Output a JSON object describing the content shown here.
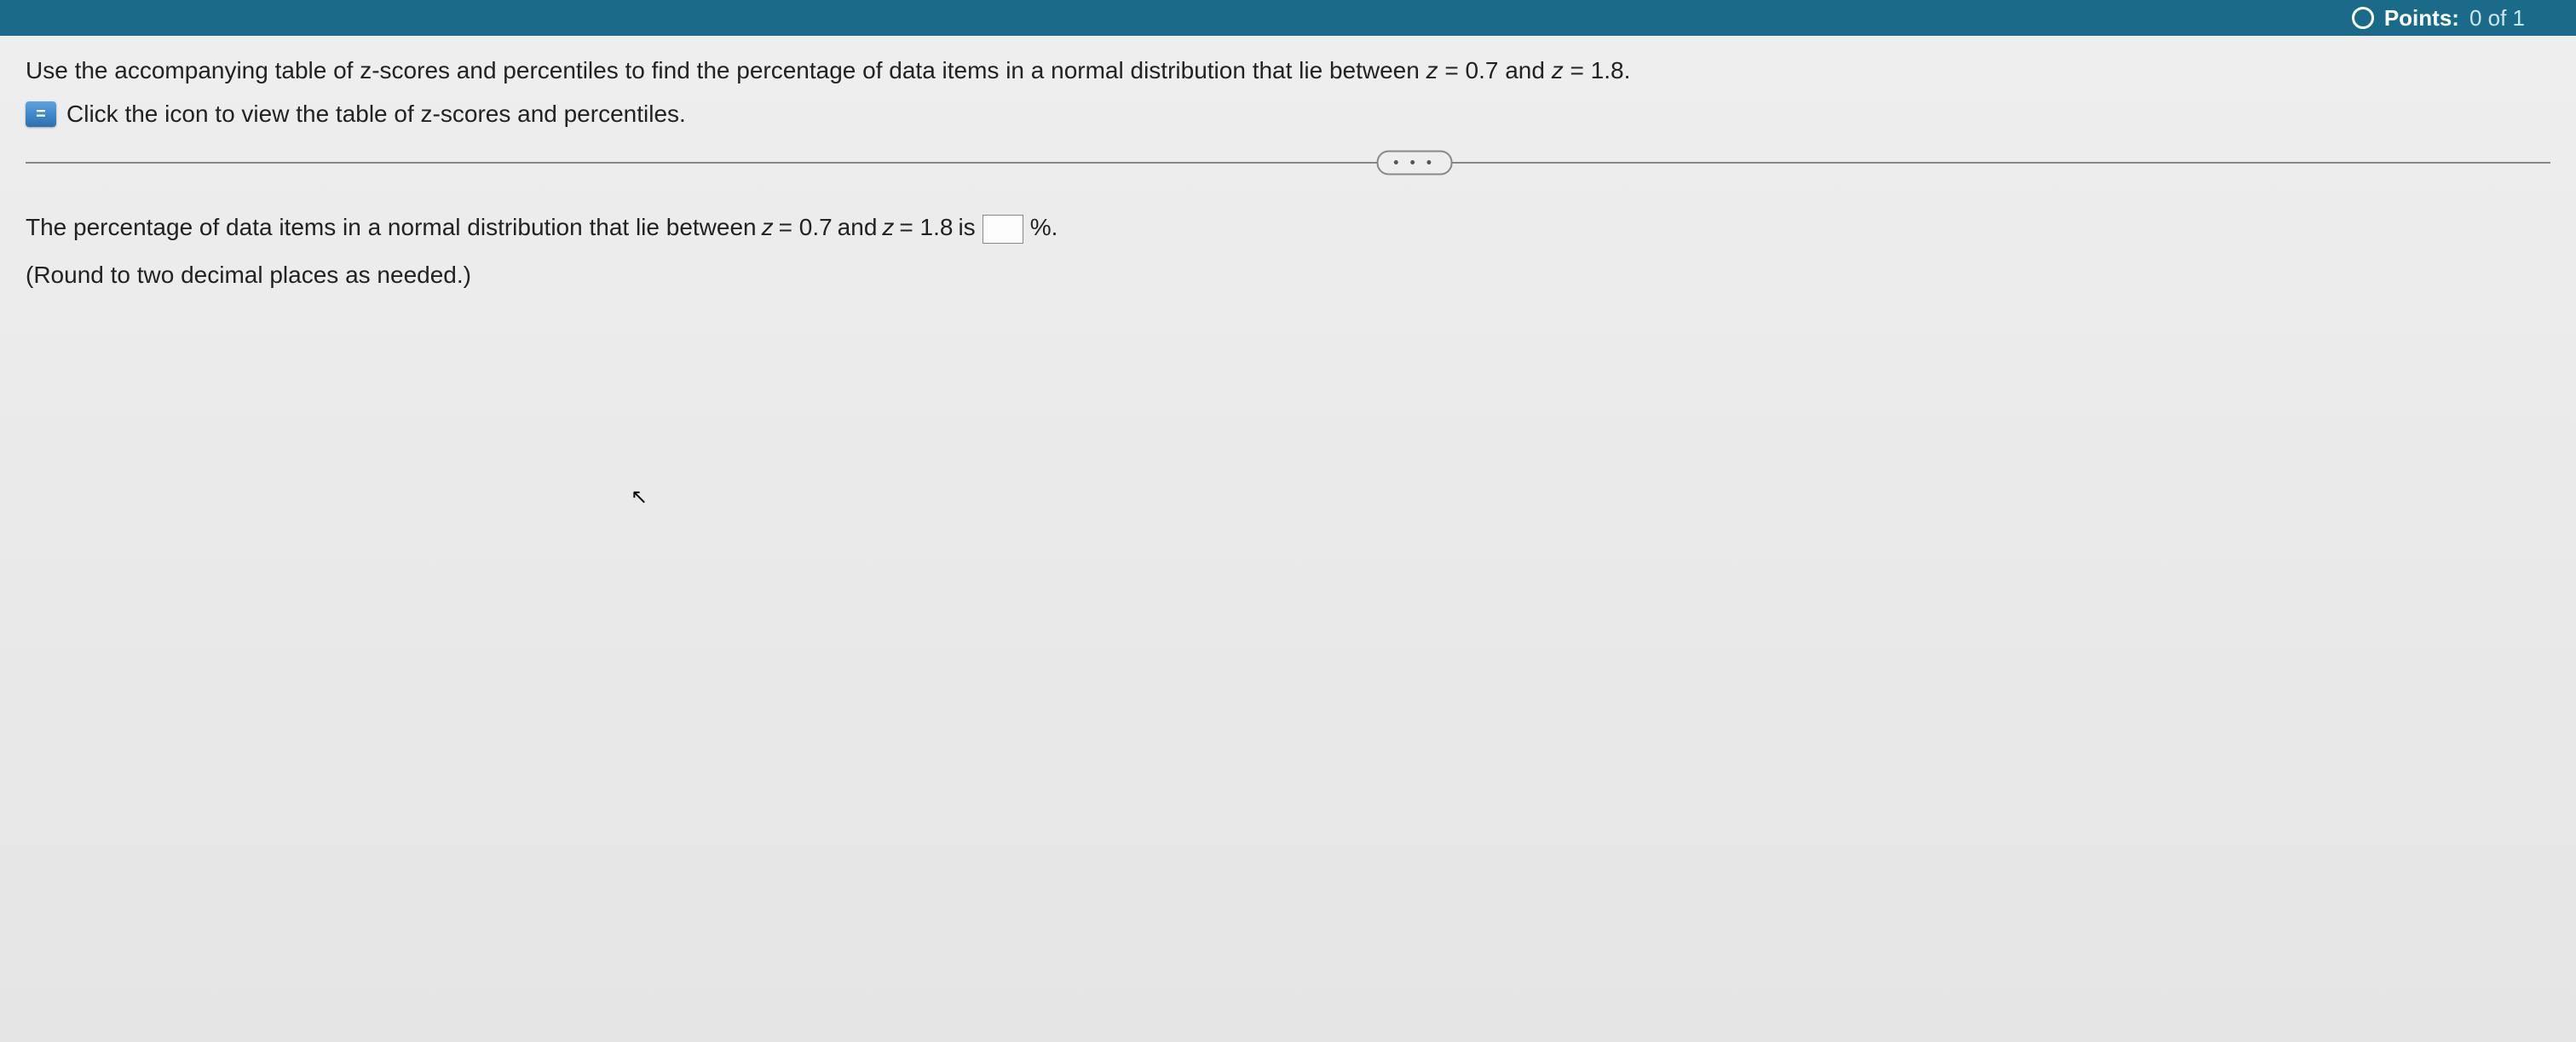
{
  "header": {
    "points_label": "Points:",
    "points_value": "0 of 1"
  },
  "question": {
    "prompt_prefix": "Use the accompanying table of z-scores and percentiles to find the percentage of data items in a normal distribution that lie between ",
    "z1_var": "z",
    "z1_eq": " = 0.7",
    "and_text": " and ",
    "z2_var": "z",
    "z2_eq": " = 1.8.",
    "link_text": "Click the icon to view the table of z-scores and percentiles."
  },
  "divider": {
    "pill": "• • •"
  },
  "answer": {
    "prefix": "The percentage of data items in a normal distribution that lie between ",
    "z1_var": "z",
    "z1_eq": " = 0.7",
    "and_text": " and ",
    "z2_var": "z",
    "z2_eq": " = 1.8",
    "is_text": " is ",
    "suffix": "%.",
    "input_value": "",
    "round_note": "(Round to two decimal places as needed.)"
  }
}
